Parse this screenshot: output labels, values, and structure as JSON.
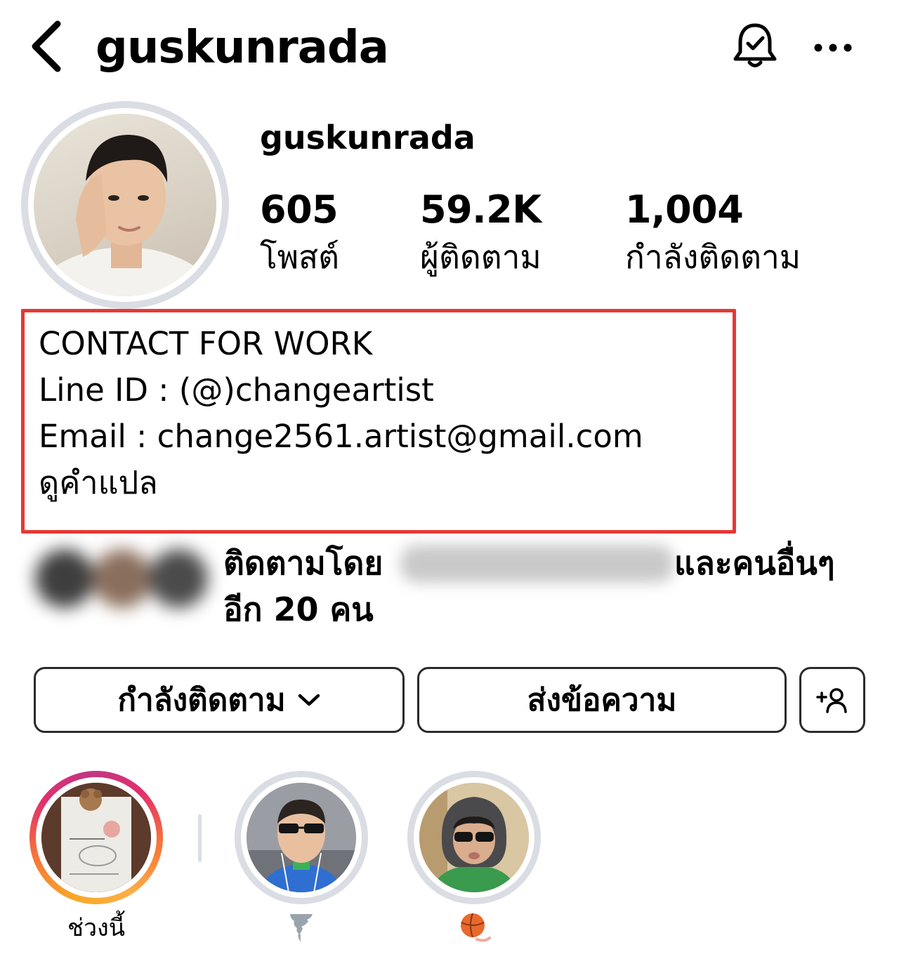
{
  "header": {
    "title": "guskunrada",
    "back_icon": "chevron-left-icon",
    "bell_icon": "bell-check-icon",
    "more_icon": "more-horizontal-icon"
  },
  "profile": {
    "username": "guskunrada",
    "stats": [
      {
        "value": "605",
        "label": "โพสต์"
      },
      {
        "value": "59.2K",
        "label": "ผู้ติดตาม"
      },
      {
        "value": "1,004",
        "label": "กำลังติดตาม"
      }
    ]
  },
  "bio": {
    "line1": "CONTACT FOR WORK",
    "line2": "Line ID : (@)changeartist",
    "line3": "Email : change2561.artist@gmail.com",
    "translate": "ดูคำแปล",
    "highlight_color": "#e53935"
  },
  "followed_by": {
    "prefix": "ติดตามโดย",
    "suffix": "และคนอื่นๆ",
    "line2_pre": "อีก ",
    "count": "20",
    "line2_post": " คน"
  },
  "actions": {
    "following_label": "กำลังติดตาม",
    "following_icon": "chevron-down-icon",
    "message_label": "ส่งข้อความ",
    "add_user_icon": "add-user-icon"
  },
  "highlights": [
    {
      "label": "ช่วงนี้",
      "ring": "gradient"
    },
    {
      "label": "",
      "emoji_icon": "tornado-icon"
    },
    {
      "label": "",
      "emoji_icon": "basketball-icon"
    }
  ]
}
